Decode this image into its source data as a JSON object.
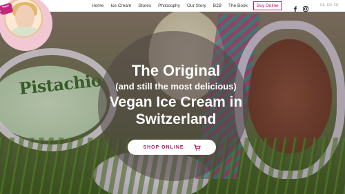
{
  "nav": {
    "items": [
      "Home",
      "Ice Cream",
      "Stores",
      "Philosophy",
      "Our Story",
      "B2B",
      "The Book"
    ],
    "cta": "Buy Online"
  },
  "social": {
    "icons": [
      "facebook-icon",
      "instagram-icon"
    ]
  },
  "languages": [
    "DE",
    "EN",
    "FR"
  ],
  "logo": {
    "badge": "Vegan"
  },
  "hero": {
    "line1": "The Original",
    "line2": "(and still the most delicious)",
    "line3": "Vegan Ice Cream in",
    "line4": "Switzerland",
    "button_label": "SHOP ONLINE",
    "tub_label": "Pistachio"
  },
  "colors": {
    "brand_magenta": "#b5176e",
    "text_white": "#ffffff"
  }
}
